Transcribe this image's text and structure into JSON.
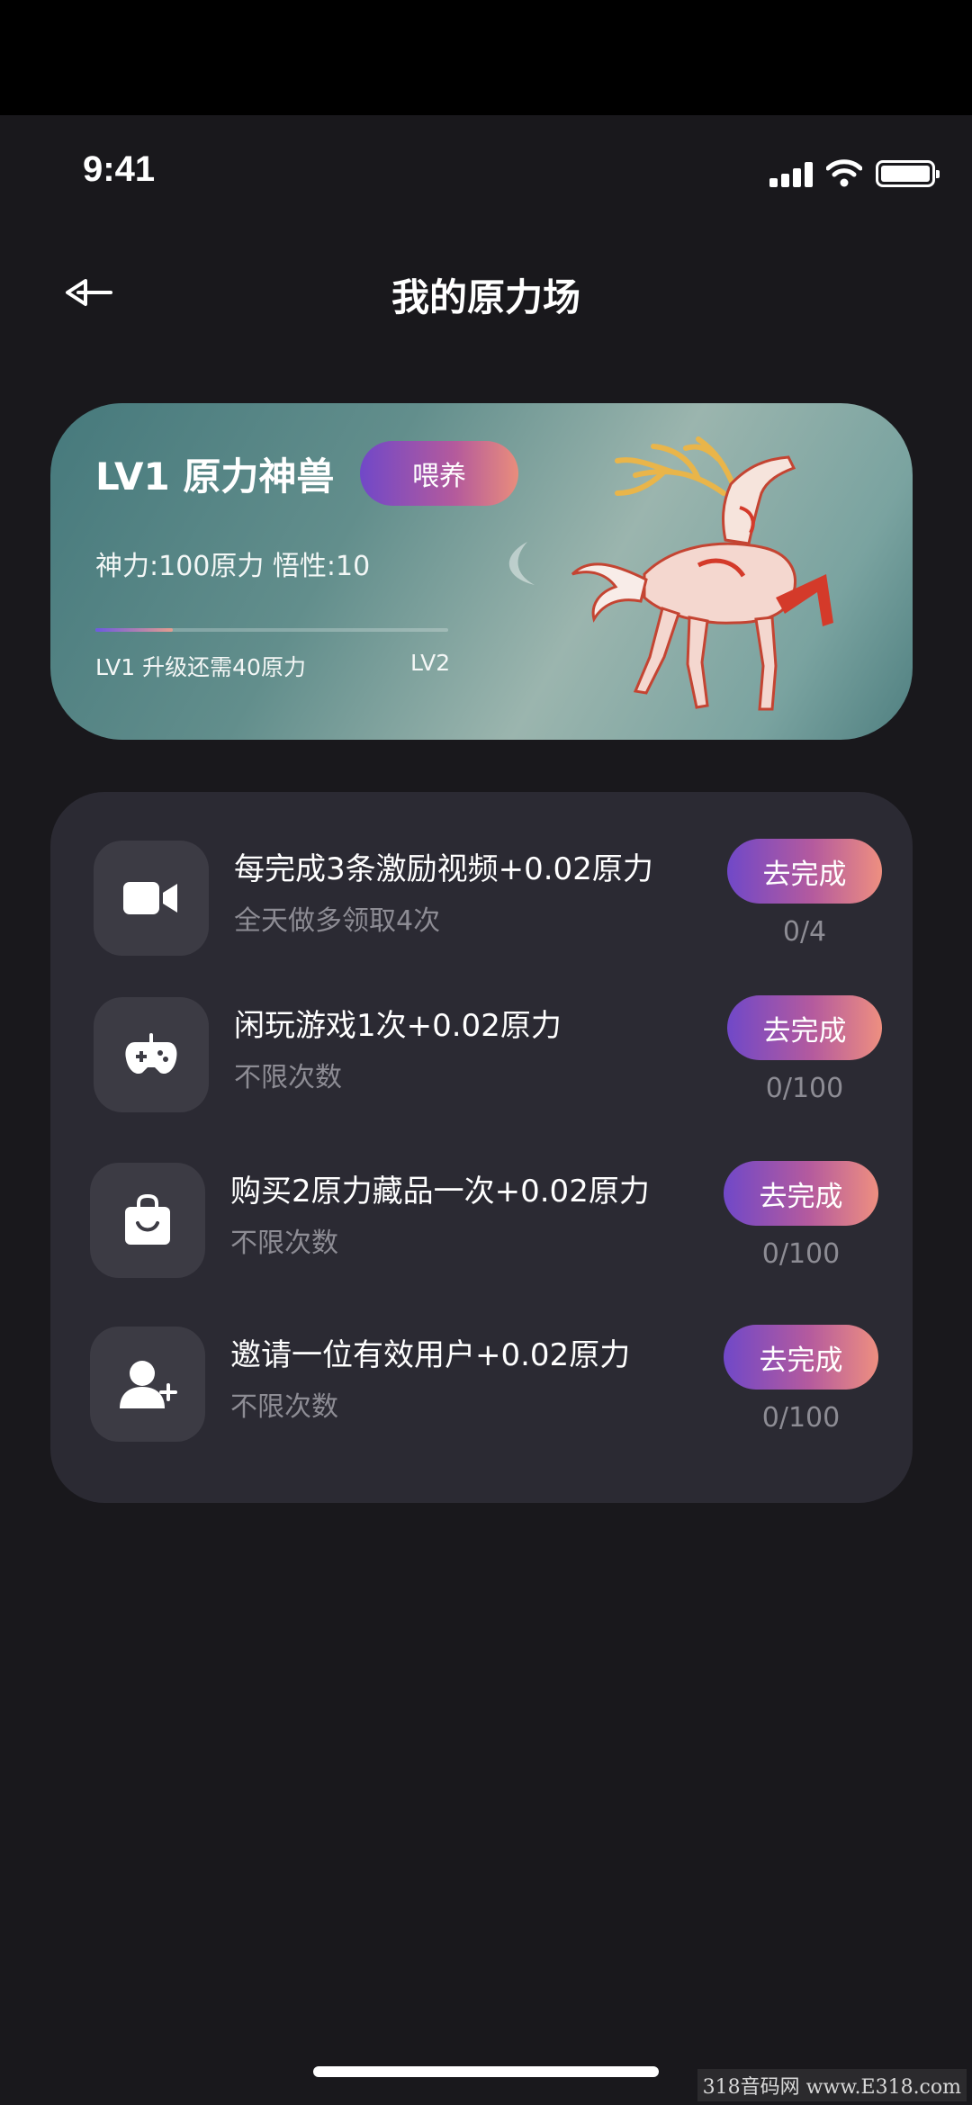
{
  "status_bar": {
    "time": "9:41"
  },
  "nav": {
    "title": "我的原力场"
  },
  "pet_card": {
    "level_title": "LV1  原力神兽",
    "feed_label": "喂养",
    "stats": "神力:100原力  悟性:10",
    "progress_left": "LV1 升级还需40原力",
    "progress_right": "LV2",
    "progress_fraction": 0.22
  },
  "tasks": [
    {
      "title": "每完成3条激励视频+0.02原力",
      "subtitle": "全天做多领取4次",
      "button": "去完成",
      "progress": "0/4",
      "icon": "video-camera-icon"
    },
    {
      "title": "闲玩游戏1次+0.02原力",
      "subtitle": "不限次数",
      "button": "去完成",
      "progress": "0/100",
      "icon": "gamepad-icon"
    },
    {
      "title": "购买2原力藏品一次+0.02原力",
      "subtitle": "不限次数",
      "button": "去完成",
      "progress": "0/100",
      "icon": "shopping-bag-icon"
    },
    {
      "title": "邀请一位有效用户+0.02原力",
      "subtitle": "不限次数",
      "button": "去完成",
      "progress": "0/100",
      "icon": "add-user-icon"
    }
  ],
  "watermark": "318音码网 www.E318.com",
  "colors": {
    "background": "#19181c",
    "card": "#2b2a33",
    "accent_start": "#7048c8",
    "accent_end": "#ee8f80"
  }
}
